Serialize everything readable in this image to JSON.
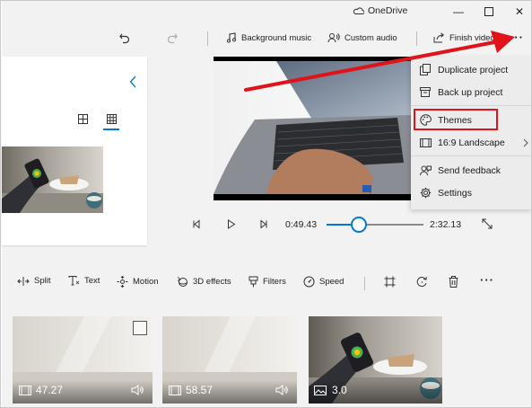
{
  "window": {
    "title": "OneDrive",
    "minimize_glyph": "—",
    "maximize_glyph": "☐",
    "close_glyph": "✕"
  },
  "toolbar": {
    "background_music": "Background music",
    "custom_audio": "Custom audio",
    "finish_video": "Finish video",
    "more_glyph": "···"
  },
  "player": {
    "current_time": "0:49.43",
    "total_time": "2:32.13",
    "progress_fraction": 0.33
  },
  "menu": {
    "items": [
      {
        "label": "Duplicate project",
        "icon": "duplicate-icon"
      },
      {
        "label": "Back up project",
        "icon": "archive-icon"
      },
      {
        "label": "Themes",
        "icon": "palette-icon"
      },
      {
        "label": "16:9 Landscape",
        "icon": "aspect-ratio-icon"
      },
      {
        "label": "Send feedback",
        "icon": "feedback-icon"
      },
      {
        "label": "Settings",
        "icon": "gear-icon"
      }
    ]
  },
  "storyboard": {
    "split": "Split",
    "text": "Text",
    "motion": "Motion",
    "effects_3d": "3D effects",
    "filters": "Filters",
    "speed": "Speed",
    "more_glyph": "···"
  },
  "clips": [
    {
      "duration": "47.27",
      "type": "video"
    },
    {
      "duration": "58.57",
      "type": "video"
    },
    {
      "duration": "3.0",
      "type": "image"
    }
  ],
  "colors": {
    "accent": "#0078d4",
    "highlight_box": "#e0131b",
    "annotation_arrow": "#e0131b"
  }
}
